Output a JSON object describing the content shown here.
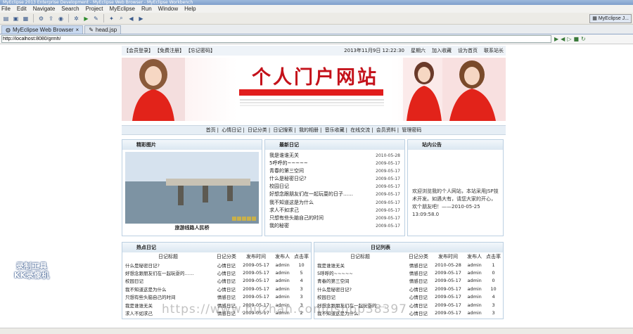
{
  "window": {
    "title": "MyEclipse 2013 Enterprise Development - MyEclipse Web Browser - MyEclipse Workbench"
  },
  "menu": [
    "File",
    "Edit",
    "Navigate",
    "Search",
    "Project",
    "MyEclipse",
    "Run",
    "Window",
    "Help"
  ],
  "perspective": "MyEclipse J...",
  "tabs": [
    {
      "label": "MyEclipse Web Browser"
    },
    {
      "label": "head.jsp"
    }
  ],
  "url": "http://localhost:8080/grmh/",
  "site": {
    "top_links": [
      "【会员登录】",
      "【免费注册】",
      "【忘记密码】"
    ],
    "datetime": "2013年11月9日 12:22:30",
    "weekday": "星期六",
    "fav": "加入收藏",
    "home": "设为首页",
    "contact": "联系站长",
    "banner_title": "个人门户网站",
    "nav": [
      "首页",
      "心情日记",
      "日记分类",
      "日记搜索",
      "我的相册",
      "音乐收藏",
      "在线交流",
      "会员资料",
      "管理密码"
    ],
    "photo_head": "精彩图片",
    "photo_caption": "旅游线路人民桥",
    "new_head": "最新日记",
    "new_list": [
      {
        "title": "我是谁谁无关",
        "date": "2010-05-28"
      },
      {
        "title": "5呼呼的~~~~~",
        "date": "2009-05-17"
      },
      {
        "title": "青春的第三空间",
        "date": "2009-05-17"
      },
      {
        "title": "什么是秘密日记?",
        "date": "2009-05-17"
      },
      {
        "title": "校园日记",
        "date": "2009-05-17"
      },
      {
        "title": "好想念跟朋友们在一起玩耍的日子……",
        "date": "2009-05-17"
      },
      {
        "title": "我不知道这是为什么",
        "date": "2009-05-17"
      },
      {
        "title": "求人不如求己",
        "date": "2009-05-17"
      },
      {
        "title": "只想有些头脑自己的时间",
        "date": "2009-05-17"
      },
      {
        "title": "我的秘密",
        "date": "2009-05-17"
      }
    ],
    "notice_head": "站内公告",
    "notice_text": "欢迎浏览我的个人网站，本站采用JSP技术开发。如遇大有，请您大家的开心，欢个朋友吧！——2010-05-25 13:09:58.0",
    "hot_head": "热点日记",
    "list_head": "日记列表",
    "cols": [
      "日记标题",
      "日记分类",
      "发布时间",
      "发布人",
      "点击率"
    ],
    "hot_rows": [
      [
        "什么是秘密日记?",
        "心情日记",
        "2009-05-17",
        "admin",
        "10"
      ],
      [
        "好想念跟朋友们在一起玩耍的……",
        "心情日记",
        "2009-05-17",
        "admin",
        "5"
      ],
      [
        "校园日记",
        "心情日记",
        "2009-05-17",
        "admin",
        "4"
      ],
      [
        "我不知道这是为什么",
        "心情日记",
        "2009-05-17",
        "admin",
        "3"
      ],
      [
        "只想有些头脑自己的时间",
        "情感日记",
        "2009-05-17",
        "admin",
        "3"
      ],
      [
        "我是谁谁无关",
        "情感日记",
        "2009-05-17",
        "admin",
        "3"
      ],
      [
        "求人不如求己",
        "情感日记",
        "2009-05-17",
        "admin",
        "2"
      ]
    ],
    "list_rows": [
      [
        "我是谁谁无关",
        "情感日记",
        "2010-05-28",
        "admin",
        "1"
      ],
      [
        "5呼呼的~~~~~",
        "情感日记",
        "2009-05-17",
        "admin",
        "0"
      ],
      [
        "青春的第三空间",
        "情感日记",
        "2009-05-17",
        "admin",
        "0"
      ],
      [
        "什么是秘密日记?",
        "心情日记",
        "2009-05-17",
        "admin",
        "10"
      ],
      [
        "校园日记",
        "心情日记",
        "2009-05-17",
        "admin",
        "4"
      ],
      [
        "好想念跟朋友们在一起玩耍的……",
        "心情日记",
        "2009-05-17",
        "admin",
        "3"
      ],
      [
        "我不知道这是为什么",
        "心情日记",
        "2009-05-17",
        "admin",
        "3"
      ]
    ]
  },
  "overlay": {
    "recorder_line1": "录制工具",
    "recorder_line2": "KK录像机",
    "url_watermark": "https://www.huzhan.com/ishop38397"
  }
}
